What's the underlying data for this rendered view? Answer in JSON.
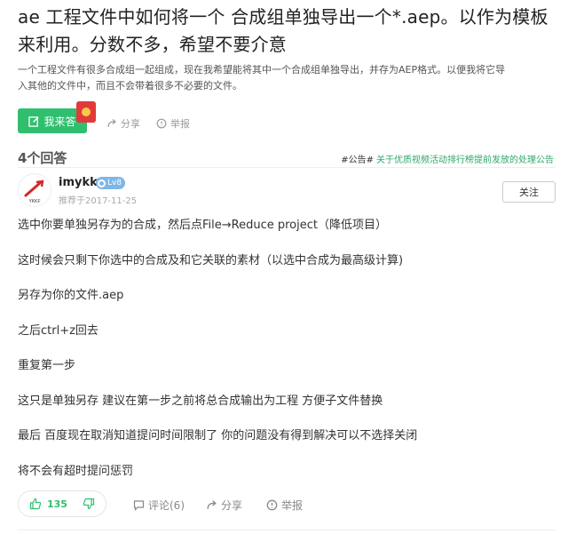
{
  "question": {
    "title_line1": "ae 工程文件中如何将一个 合成组单独导出一个*.aep。以作为模板",
    "title_line2": "来利用。分数不多，希望不要介意",
    "desc_line1": "一个工程文件有很多合成组一起组成，现在我希望能将其中一个合成组单独导出，并存为AEP格式。以便我将它导",
    "desc_line2": "入其他的文件中，而且不会带着很多不必要的文件。",
    "answer_button": "我来答",
    "share_label": "分享",
    "report_label": "举报"
  },
  "answers_header": {
    "count_label": "4个回答",
    "notice_tag": "#公告#",
    "notice_link": "关于优质视频活动排行榜提前发放的处理公告"
  },
  "answer": {
    "username": "imykk",
    "level": "Lv8",
    "avatar_text": "YKKF",
    "recommended_date": "推荐于2017-11-25",
    "follow_label": "关注",
    "lines": [
      "选中你要单独另存为的合成，然后点File→Reduce project（降低项目）",
      "这时候会只剩下你选中的合成及和它关联的素材（以选中合成为最高级计算)",
      "另存为你的文件.aep",
      "之后ctrl+z回去",
      "重复第一步",
      "这只是单独另存 建议在第一步之前将总合成输出为工程 方便子文件替换",
      "最后 百度现在取消知道提问时间限制了 你的问题没有得到解决可以不选择关闭",
      "将不会有超时提问惩罚"
    ],
    "votes": "135",
    "comment_label": "评论(6)",
    "share_label": "分享",
    "report_label": "举报"
  },
  "colors": {
    "accent_green": "#2fbf6f",
    "level_badge": "#7eb6e8",
    "notice_link": "#2ea86a"
  },
  "icons": [
    "edit-icon",
    "red-envelope-icon",
    "share-icon",
    "report-icon",
    "level-icon",
    "thumb-up-icon",
    "thumb-down-icon",
    "comment-icon"
  ]
}
